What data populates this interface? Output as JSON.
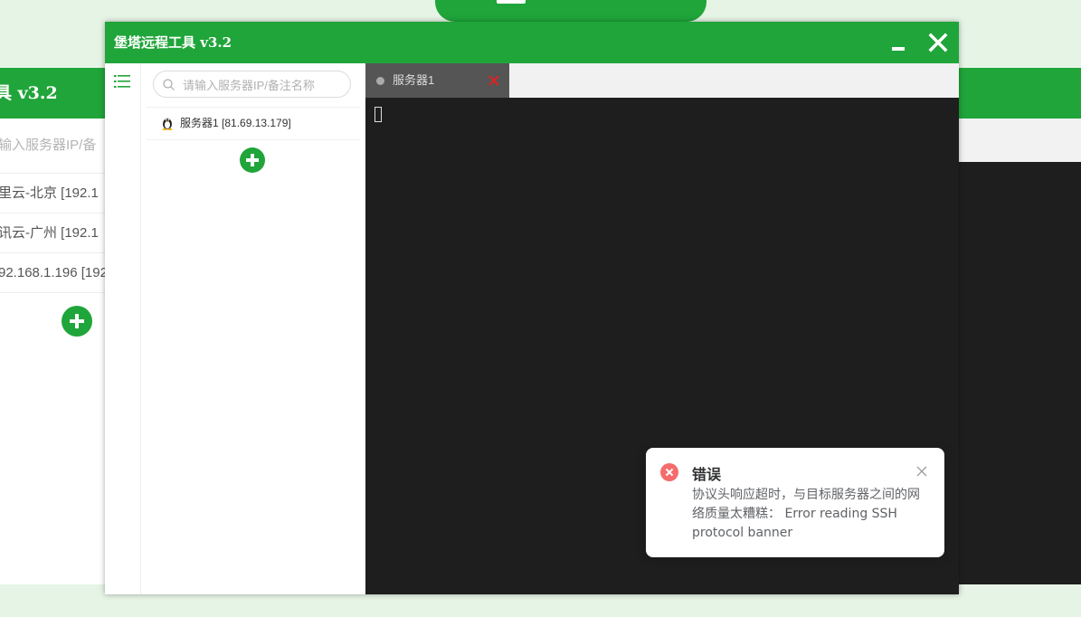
{
  "background_app": {
    "header_title": "具 v3.2",
    "search_placeholder": "输入服务器IP/备",
    "servers": [
      "里云-北京 [192.1",
      "讯云-广州 [192.1",
      "92.168.1.196 [192"
    ]
  },
  "window": {
    "title": "堡塔远程工具 v3.2",
    "minimize_icon": "minimize-icon",
    "close_icon": "close-icon"
  },
  "sidebar": {
    "menu_icon": "list-icon"
  },
  "server_panel": {
    "search_placeholder": "请输入服务器IP/备注名称",
    "search_value": "",
    "servers": [
      {
        "label": "服务器1 [81.69.13.179]",
        "os_icon": "linux-icon"
      }
    ],
    "add_icon": "plus-icon"
  },
  "tabs": [
    {
      "label": "服务器1",
      "status_color": "#aaaaaa",
      "close_color": "#e02020"
    }
  ],
  "notification": {
    "type": "error",
    "title": "错误",
    "message": "协议头响应超时，与目标服务器之间的网络质量太糟糕： Error reading SSH protocol banner"
  },
  "colors": {
    "brand_green": "#20a53a",
    "terminal_bg": "#1e1e1e",
    "error_red": "#f56c6c"
  }
}
